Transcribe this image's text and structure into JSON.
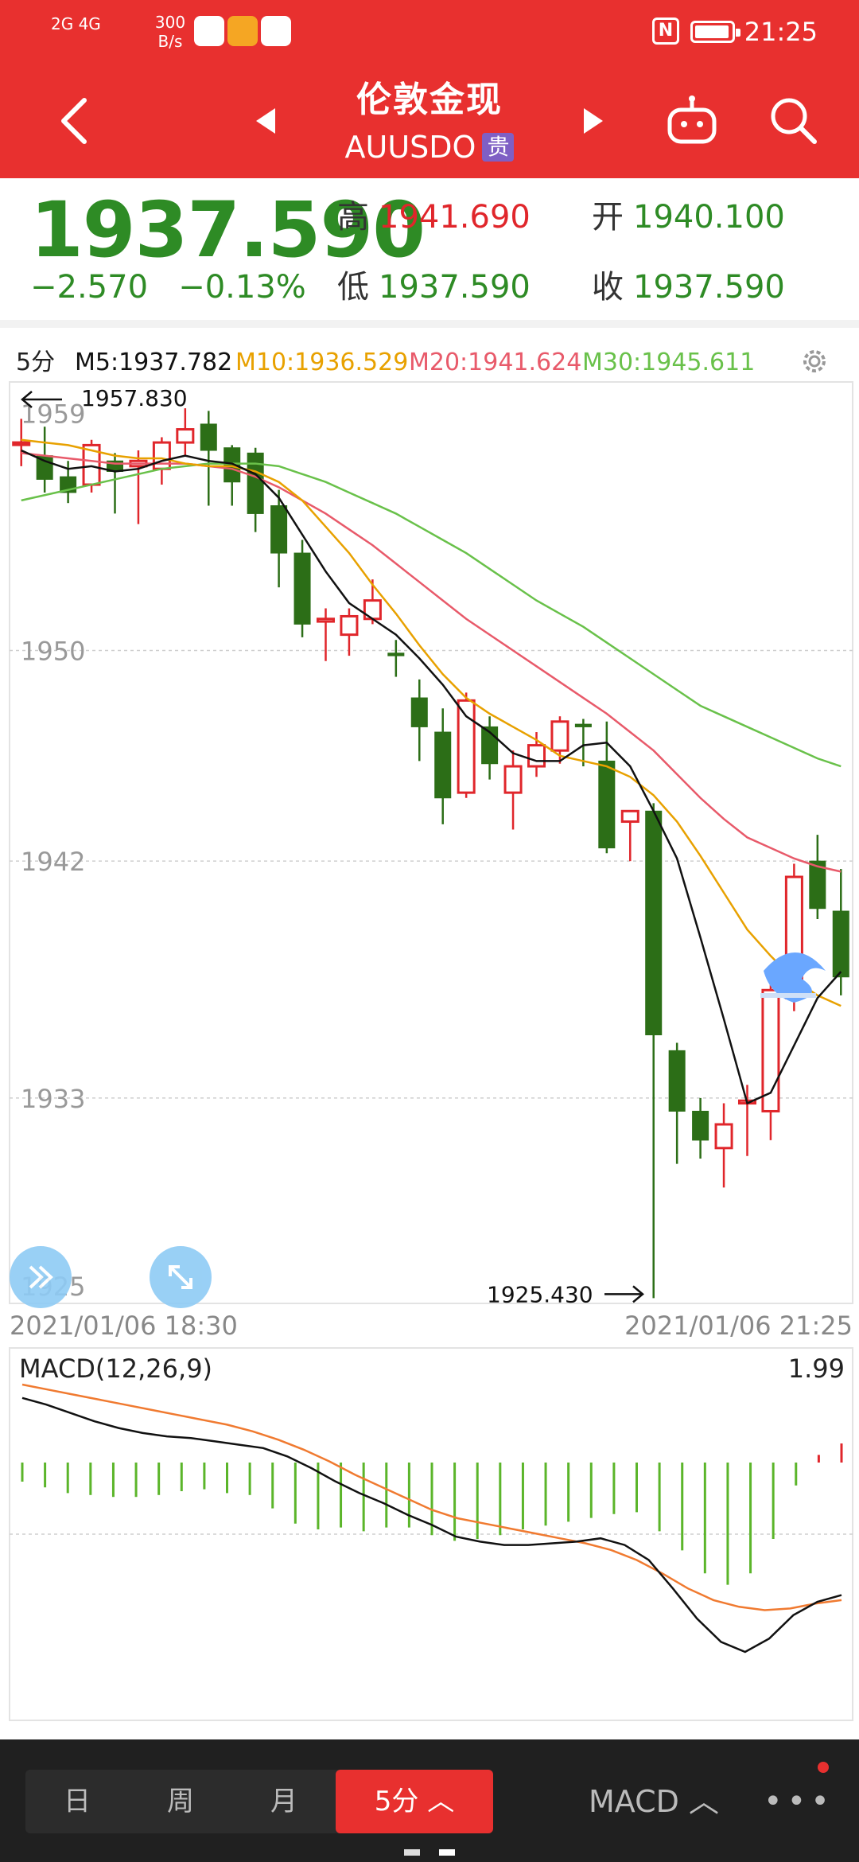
{
  "status_bar": {
    "network": "2G 4G",
    "rate_line1": "300",
    "rate_line2": "B/s",
    "time": "21:25"
  },
  "header": {
    "title": "伦敦金现",
    "symbol": "AUUSDO",
    "tag": "贵"
  },
  "quote": {
    "price": "1937.590",
    "change": "−2.570",
    "change_pct": "−0.13%",
    "high_label": "高",
    "high": "1941.690",
    "open_label": "开",
    "open": "1940.100",
    "low_label": "低",
    "low": "1937.590",
    "close_label": "收",
    "close": "1937.590"
  },
  "ma_bar": {
    "period": "5分",
    "m5": "M5:1937.782",
    "m10": "M10:1936.529",
    "m20": "M20:1941.624",
    "m30": "M30:1945.611"
  },
  "colors": {
    "up": "#e0262b",
    "down": "#2c6e17",
    "m5": "#111111",
    "m10": "#e8a100",
    "m20": "#e85a6a",
    "m30": "#69c14a",
    "dif": "#111111",
    "dea": "#f07a30",
    "header_bg": "#e8302f"
  },
  "chart_data": {
    "type": "candlestick",
    "title": "伦敦金现 5分",
    "y_ticks": [
      "1959",
      "1950",
      "1942",
      "1933",
      "1925"
    ],
    "y_tick_values": [
      1959,
      1950,
      1942,
      1933,
      1925
    ],
    "ylim": [
      1925,
      1960
    ],
    "max_label": "1957.830",
    "min_label": "1925.430",
    "x_start": "2021/01/06 18:30",
    "x_end": "2021/01/06 21:25",
    "candles": [
      [
        1957.9,
        1957.9,
        1958.8,
        1957.0
      ],
      [
        1957.4,
        1956.5,
        1958.5,
        1956.0
      ],
      [
        1956.6,
        1956.0,
        1957.2,
        1955.6
      ],
      [
        1956.3,
        1957.8,
        1958.0,
        1956.0
      ],
      [
        1957.2,
        1956.8,
        1957.5,
        1955.2
      ],
      [
        1957.0,
        1957.2,
        1957.6,
        1954.8
      ],
      [
        1956.9,
        1957.9,
        1958.1,
        1956.3
      ],
      [
        1957.9,
        1958.4,
        1959.2,
        1957.4
      ],
      [
        1958.6,
        1957.6,
        1959.1,
        1955.5
      ],
      [
        1957.7,
        1956.4,
        1957.8,
        1955.5
      ],
      [
        1957.5,
        1955.2,
        1957.7,
        1954.5
      ],
      [
        1955.5,
        1953.7,
        1956.1,
        1952.4
      ],
      [
        1953.7,
        1951.0,
        1954.2,
        1950.5
      ],
      [
        1951.1,
        1951.2,
        1951.6,
        1949.6
      ],
      [
        1950.6,
        1951.3,
        1951.6,
        1949.8
      ],
      [
        1951.2,
        1951.9,
        1952.7,
        1951.0
      ],
      [
        1949.9,
        1949.8,
        1950.4,
        1949.0
      ],
      [
        1948.2,
        1947.1,
        1948.9,
        1945.8
      ],
      [
        1946.9,
        1944.4,
        1947.8,
        1943.4
      ],
      [
        1944.6,
        1948.1,
        1948.4,
        1944.4
      ],
      [
        1947.1,
        1945.7,
        1947.5,
        1945.1
      ],
      [
        1944.6,
        1945.6,
        1946.2,
        1943.2
      ],
      [
        1945.6,
        1946.4,
        1946.9,
        1945.2
      ],
      [
        1946.2,
        1947.3,
        1947.5,
        1945.7
      ],
      [
        1947.2,
        1947.1,
        1947.4,
        1945.6
      ],
      [
        1945.8,
        1942.5,
        1947.3,
        1942.3
      ],
      [
        1943.5,
        1943.9,
        1943.8,
        1942.0
      ],
      [
        1943.9,
        1935.4,
        1944.2,
        1925.4
      ],
      [
        1934.8,
        1932.5,
        1935.1,
        1930.5
      ],
      [
        1932.5,
        1931.4,
        1933.0,
        1930.7
      ],
      [
        1931.1,
        1932.0,
        1932.8,
        1929.6
      ],
      [
        1932.8,
        1932.9,
        1933.5,
        1930.8
      ],
      [
        1932.5,
        1937.1,
        1937.6,
        1931.4
      ],
      [
        1936.8,
        1941.4,
        1941.9,
        1936.3
      ],
      [
        1942.0,
        1940.2,
        1943.0,
        1939.8
      ],
      [
        1940.1,
        1937.6,
        1941.7,
        1936.9
      ]
    ],
    "ma5": [
      1957.6,
      1957.2,
      1956.9,
      1957.0,
      1956.8,
      1956.9,
      1957.2,
      1957.4,
      1957.2,
      1957.1,
      1956.7,
      1955.8,
      1954.4,
      1953.0,
      1951.8,
      1951.2,
      1950.6,
      1949.7,
      1948.7,
      1947.5,
      1946.9,
      1946.1,
      1945.8,
      1945.8,
      1946.4,
      1946.5,
      1945.6,
      1943.9,
      1942.1,
      1939.1,
      1936.0,
      1932.8,
      1933.2,
      1935.0,
      1936.8,
      1937.8
    ],
    "ma10": [
      1958.0,
      1957.9,
      1957.8,
      1957.6,
      1957.4,
      1957.3,
      1957.3,
      1957.1,
      1957.0,
      1957.0,
      1956.8,
      1956.4,
      1955.7,
      1954.7,
      1953.7,
      1952.5,
      1951.4,
      1950.2,
      1949.1,
      1948.2,
      1947.6,
      1947.1,
      1946.6,
      1946.0,
      1945.8,
      1945.6,
      1945.2,
      1944.5,
      1943.5,
      1942.2,
      1940.8,
      1939.4,
      1938.4,
      1937.5,
      1936.9,
      1936.5
    ],
    "ma20": [
      1957.5,
      1957.4,
      1957.3,
      1957.2,
      1957.1,
      1957.1,
      1957.1,
      1957.1,
      1957.0,
      1956.9,
      1956.6,
      1956.2,
      1955.7,
      1955.2,
      1954.6,
      1954.0,
      1953.3,
      1952.6,
      1951.9,
      1951.2,
      1950.6,
      1950.0,
      1949.4,
      1948.8,
      1948.2,
      1947.6,
      1946.9,
      1946.2,
      1945.3,
      1944.4,
      1943.6,
      1942.9,
      1942.5,
      1942.1,
      1941.8,
      1941.6
    ],
    "ma30": [
      1955.7,
      1955.9,
      1956.1,
      1956.3,
      1956.5,
      1956.7,
      1956.9,
      1957.0,
      1957.1,
      1957.1,
      1957.1,
      1957.0,
      1956.7,
      1956.4,
      1956.0,
      1955.6,
      1955.2,
      1954.7,
      1954.2,
      1953.7,
      1953.1,
      1952.5,
      1951.9,
      1951.4,
      1950.9,
      1950.3,
      1949.7,
      1949.1,
      1948.5,
      1947.9,
      1947.5,
      1947.1,
      1946.7,
      1946.3,
      1945.9,
      1945.6
    ]
  },
  "macd": {
    "label": "MACD(12,26,9)",
    "value": "1.99",
    "hist": [
      -1.0,
      -1.3,
      -1.6,
      -1.7,
      -1.8,
      -1.8,
      -1.7,
      -1.5,
      -1.4,
      -1.6,
      -1.7,
      -2.4,
      -3.2,
      -3.5,
      -3.4,
      -3.6,
      -3.4,
      -3.4,
      -3.8,
      -4.1,
      -4.0,
      -3.8,
      -3.5,
      -3.3,
      -3.1,
      -2.9,
      -2.7,
      -2.6,
      -3.6,
      -4.6,
      -5.8,
      -6.4,
      -5.8,
      -4.0,
      -1.2,
      0.4,
      1.0
    ],
    "dif": [
      1.2,
      0.8,
      0.3,
      -0.2,
      -0.6,
      -0.9,
      -1.1,
      -1.2,
      -1.4,
      -1.6,
      -1.8,
      -2.3,
      -3.0,
      -3.8,
      -4.5,
      -5.1,
      -5.8,
      -6.4,
      -7.1,
      -7.4,
      -7.6,
      -7.6,
      -7.5,
      -7.4,
      -7.2,
      -7.6,
      -8.5,
      -10.2,
      -12.0,
      -13.4,
      -14.0,
      -13.2,
      -11.8,
      -11.0,
      -10.6
    ],
    "dea": [
      2.0,
      1.7,
      1.4,
      1.1,
      0.8,
      0.5,
      0.2,
      -0.1,
      -0.4,
      -0.8,
      -1.3,
      -1.9,
      -2.6,
      -3.4,
      -4.1,
      -4.8,
      -5.5,
      -6.0,
      -6.3,
      -6.6,
      -6.9,
      -7.2,
      -7.5,
      -7.9,
      -8.5,
      -9.3,
      -10.2,
      -10.9,
      -11.3,
      -11.5,
      -11.4,
      -11.1,
      -10.9
    ]
  },
  "bottom_bar": {
    "tab_day": "日",
    "tab_week": "周",
    "tab_month": "月",
    "tab_5min": "5分 ︿",
    "macd_btn": "MACD ︿",
    "more": "•••"
  }
}
